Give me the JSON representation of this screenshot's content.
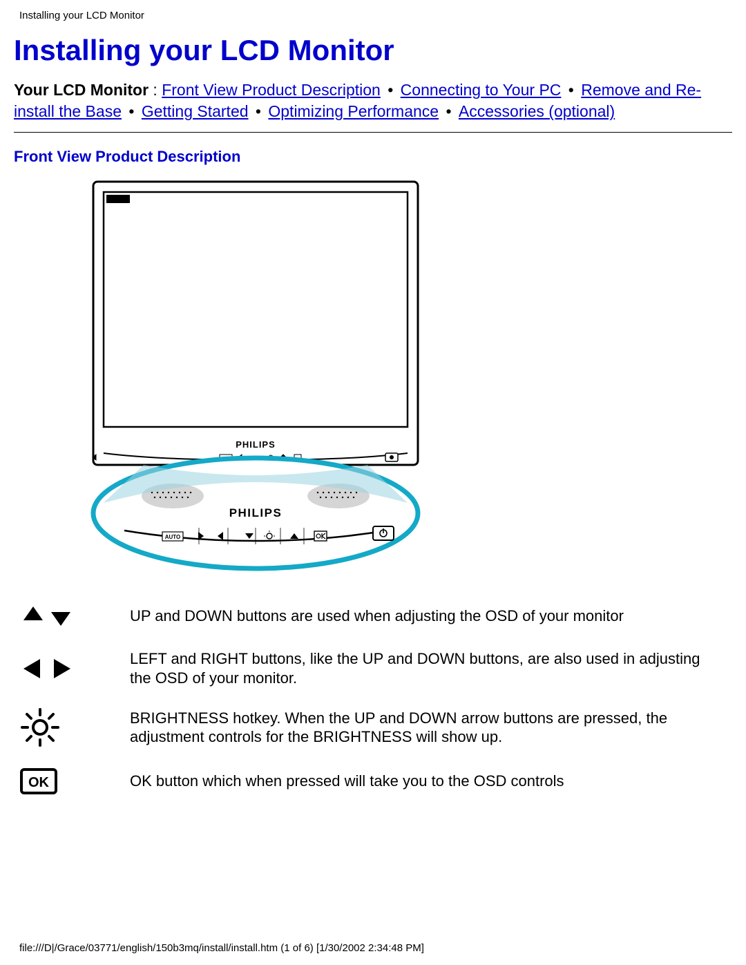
{
  "header": {
    "doc_title": "Installing your LCD Monitor"
  },
  "title": "Installing your LCD Monitor",
  "intro": {
    "label": "Your LCD Monitor",
    "colon": " : ",
    "links": {
      "front_view": "Front View Product Description",
      "connecting": "Connecting to Your PC",
      "remove_reinstall": "Remove and Re-install the Base",
      "getting_started": "Getting Started",
      "optimizing": "Optimizing Performance",
      "accessories": "Accessories (optional)"
    },
    "bullet": " • "
  },
  "section_heading": "Front View Product Description",
  "figure": {
    "brand": "PHILIPS",
    "auto_label": "AUTO"
  },
  "legend": [
    {
      "icon": "up-down-icon",
      "desc": "UP and DOWN buttons are used when adjusting the OSD of your monitor"
    },
    {
      "icon": "left-right-icon",
      "desc": "LEFT and RIGHT buttons, like the UP and DOWN buttons, are also used in adjusting the OSD of your monitor."
    },
    {
      "icon": "brightness-icon",
      "desc": "BRIGHTNESS hotkey. When the UP and DOWN arrow buttons are pressed, the adjustment controls for the BRIGHTNESS will show up."
    },
    {
      "icon": "ok-icon",
      "desc": "OK button which when pressed will take you to the OSD controls"
    }
  ],
  "footer": {
    "path": "file:///D|/Grace/03771/english/150b3mq/install/install.htm (1 of 6) [1/30/2002 2:34:48 PM]"
  }
}
